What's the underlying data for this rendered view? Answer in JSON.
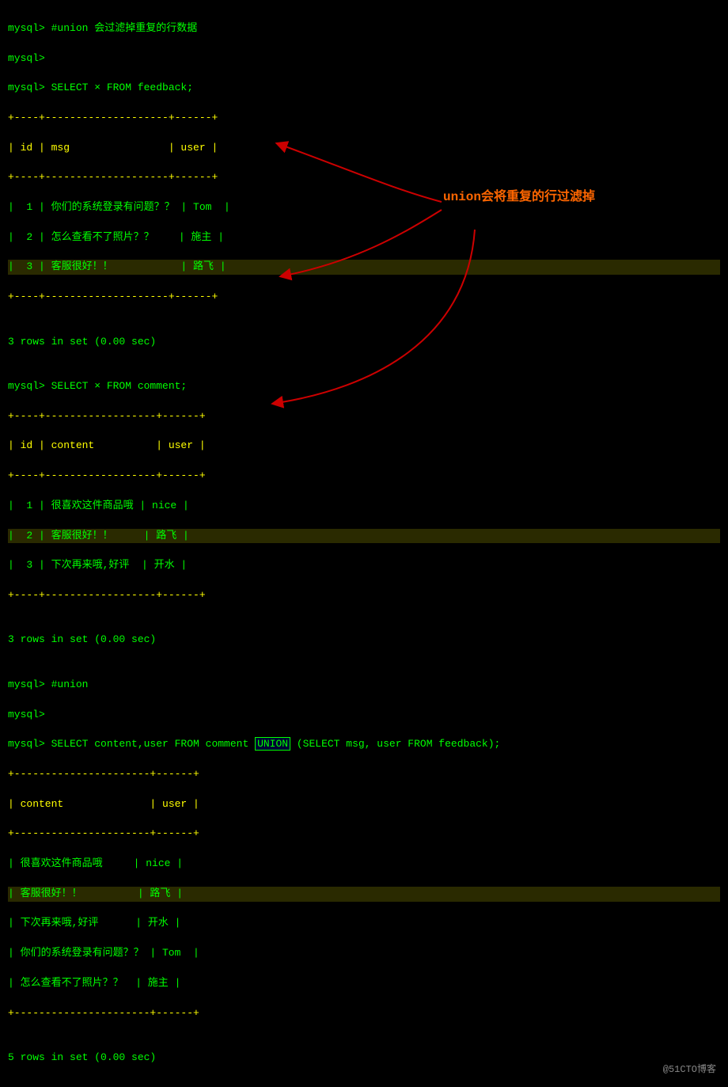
{
  "terminal": {
    "lines": [
      {
        "id": "l1",
        "text": "mysql> #union 会过滤掉重复的行数据",
        "type": "normal"
      },
      {
        "id": "l2",
        "text": "mysql>",
        "type": "normal"
      },
      {
        "id": "l3",
        "text": "mysql> SELECT × FROM feedback;",
        "type": "normal"
      },
      {
        "id": "l4",
        "text": "+----+--------------------+------+",
        "type": "normal"
      },
      {
        "id": "l5",
        "text": "| id | msg                | user |",
        "type": "normal"
      },
      {
        "id": "l6",
        "text": "+----+--------------------+------+",
        "type": "normal"
      },
      {
        "id": "l7",
        "text": "|  1 | 你们的系统登录有问题？？ | Tom  |",
        "type": "normal"
      },
      {
        "id": "l8",
        "text": "|  2 | 怎么查看不了照片？？   | 施主 |",
        "type": "normal"
      },
      {
        "id": "l9",
        "text": "|  3 | 客服很好！！          | 路飞 |",
        "type": "highlight"
      },
      {
        "id": "l10",
        "text": "+----+--------------------+------+",
        "type": "normal"
      },
      {
        "id": "l11",
        "text": "",
        "type": "normal"
      },
      {
        "id": "l12",
        "text": "3 rows in set (0.00 sec)",
        "type": "normal"
      },
      {
        "id": "l13",
        "text": "",
        "type": "normal"
      },
      {
        "id": "l14",
        "text": "mysql> SELECT × FROM comment;",
        "type": "normal"
      },
      {
        "id": "l15",
        "text": "+----+------------------+------+",
        "type": "normal"
      },
      {
        "id": "l16",
        "text": "| id | content          | user |",
        "type": "normal"
      },
      {
        "id": "l17",
        "text": "+----+------------------+------+",
        "type": "normal"
      },
      {
        "id": "l18",
        "text": "|  1 | 很喜欢这件商品哦 | nice |",
        "type": "normal"
      },
      {
        "id": "l19",
        "text": "|  2 | 客服很好！！     | 路飞 |",
        "type": "highlight"
      },
      {
        "id": "l20",
        "text": "|  3 | 下次再来哦,好评  | 开水 |",
        "type": "normal"
      },
      {
        "id": "l21",
        "text": "+----+------------------+------+",
        "type": "normal"
      },
      {
        "id": "l22",
        "text": "",
        "type": "normal"
      },
      {
        "id": "l23",
        "text": "3 rows in set (0.00 sec)",
        "type": "normal"
      },
      {
        "id": "l24",
        "text": "",
        "type": "normal"
      },
      {
        "id": "l25",
        "text": "mysql> #union",
        "type": "normal"
      },
      {
        "id": "l26",
        "text": "mysql>",
        "type": "normal"
      },
      {
        "id": "l27",
        "text": "mysql> SELECT content,user FROM comment UNION (SELECT msg, user FROM feedback);",
        "type": "union"
      },
      {
        "id": "l28",
        "text": "+----------------------+------+",
        "type": "normal"
      },
      {
        "id": "l29",
        "text": "| content              | user |",
        "type": "normal"
      },
      {
        "id": "l30",
        "text": "+----------------------+------+",
        "type": "normal"
      },
      {
        "id": "l31",
        "text": "| 很喜欢这件商品哦     | nice |",
        "type": "normal"
      },
      {
        "id": "l32",
        "text": "| 客服很好！！         | 路飞 |",
        "type": "highlight2"
      },
      {
        "id": "l33",
        "text": "| 下次再来哦,好评      | 开水 |",
        "type": "normal"
      },
      {
        "id": "l34",
        "text": "| 你们的系统登录有问题？？ | Tom  |",
        "type": "normal"
      },
      {
        "id": "l35",
        "text": "| 怎么查看不了照片？？  | 施主 |",
        "type": "normal"
      },
      {
        "id": "l36",
        "text": "+----------------------+------+",
        "type": "normal"
      },
      {
        "id": "l37",
        "text": "",
        "type": "normal"
      },
      {
        "id": "l38",
        "text": "5 rows in set (0.00 sec)",
        "type": "normal"
      }
    ],
    "annotation": "union会将重复的行过滤掉",
    "watermark": "@51CTO博客"
  }
}
